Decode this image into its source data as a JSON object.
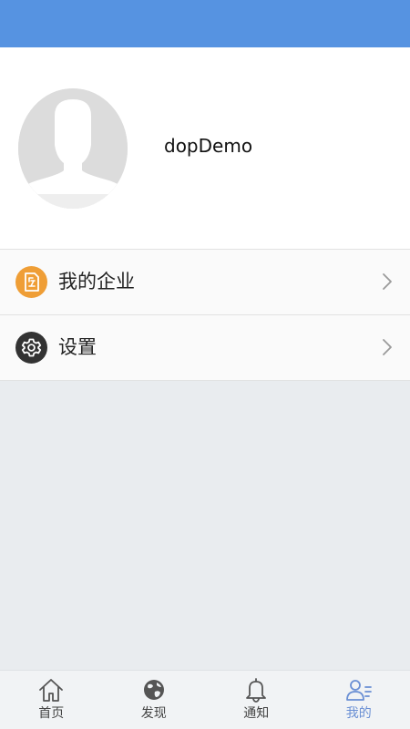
{
  "profile": {
    "username": "dopDemo"
  },
  "menu": {
    "items": [
      {
        "label": "我的企业",
        "icon": "company-doc-icon",
        "color": "#ef9e36"
      },
      {
        "label": "设置",
        "icon": "gear-icon",
        "color": "#333333"
      }
    ]
  },
  "tabbar": {
    "tabs": [
      {
        "label": "首页",
        "icon": "home-icon"
      },
      {
        "label": "发现",
        "icon": "globe-icon"
      },
      {
        "label": "通知",
        "icon": "bell-icon"
      },
      {
        "label": "我的",
        "icon": "profile-icon",
        "active": true
      }
    ],
    "active_color": "#6a8fd4"
  },
  "colors": {
    "status_bar": "#5693e1",
    "background": "#e9ecef"
  }
}
